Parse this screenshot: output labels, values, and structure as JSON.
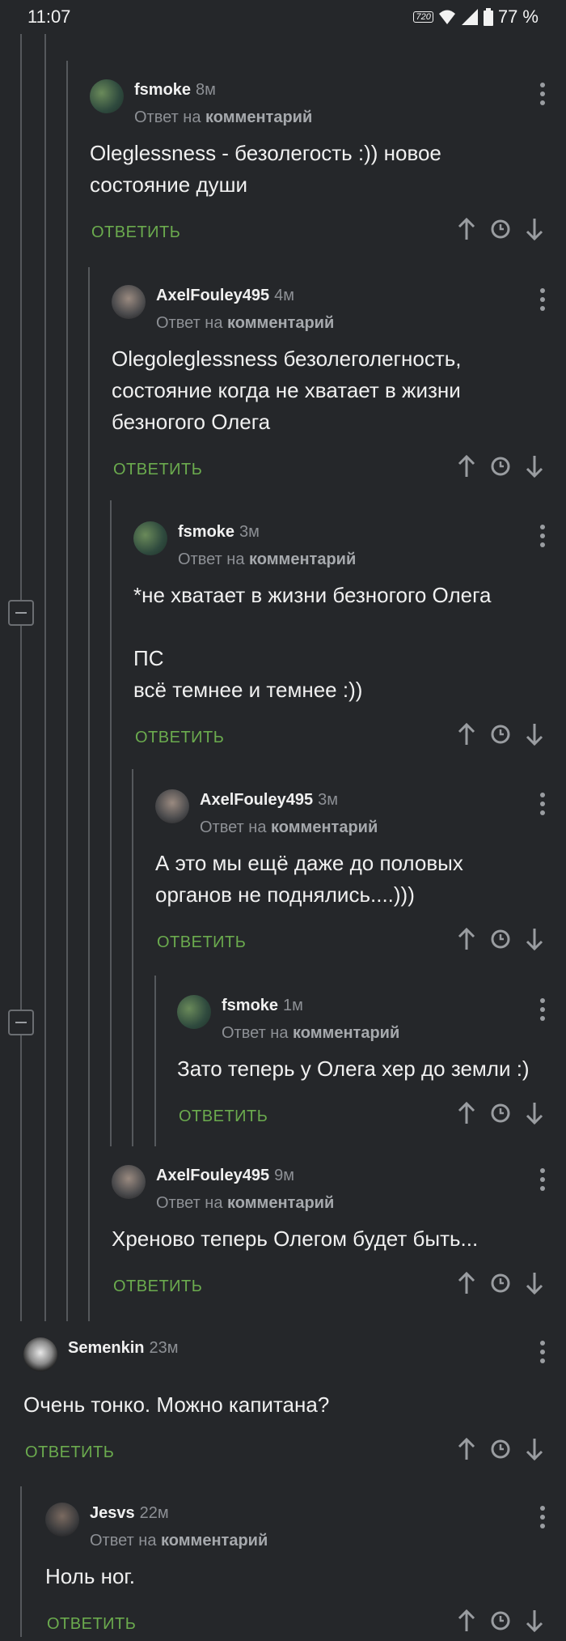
{
  "status_bar": {
    "time": "11:07",
    "battery": "77 %",
    "hd_label": "720"
  },
  "colors": {
    "accent_green": "#6bab4e",
    "background": "#25272a",
    "thread_line": "#55585c"
  },
  "icons": {
    "upvote": "arrow-up-icon",
    "history": "clock-icon",
    "downvote": "arrow-down-icon",
    "menu": "more-vertical-icon",
    "collapse": "minus-square-icon"
  },
  "comments": [
    {
      "author": "fsmoke",
      "time": "8м",
      "reply_to": "Ответ на",
      "reply_to_target": "комментарий",
      "text": "Oleglessness - безолегость :)) новое\nсостояние души",
      "reply_label": "ОТВЕТИТЬ"
    },
    {
      "author": "AxelFouley495",
      "time": "4м",
      "reply_to": "Ответ на",
      "reply_to_target": "комментарий",
      "text": "Olegoleglessness безолеголегность,\nсостояние когда не хватает в жизни\nбезногого Олега",
      "reply_label": "ОТВЕТИТЬ"
    },
    {
      "author": "fsmoke",
      "time": "3м",
      "reply_to": "Ответ на",
      "reply_to_target": "комментарий",
      "text": "*не хватает в жизни безногого Олега\n\nПС\nвсё темнее и темнее :))",
      "reply_label": "ОТВЕТИТЬ"
    },
    {
      "author": "AxelFouley495",
      "time": "3м",
      "reply_to": "Ответ на",
      "reply_to_target": "комментарий",
      "text": "А это мы ещё даже до половых\nорганов не поднялись....)))",
      "reply_label": "ОТВЕТИТЬ"
    },
    {
      "author": "fsmoke",
      "time": "1м",
      "reply_to": "Ответ на",
      "reply_to_target": "комментарий",
      "text": "Зато теперь у Олега хер до земли :)",
      "reply_label": "ОТВЕТИТЬ"
    },
    {
      "author": "AxelFouley495",
      "time": "9м",
      "reply_to": "Ответ на",
      "reply_to_target": "комментарий",
      "text": "Хреново теперь Олегом будет быть...",
      "reply_label": "ОТВЕТИТЬ"
    },
    {
      "author": "Semenkin",
      "time": "23м",
      "reply_to": "",
      "reply_to_target": "",
      "text": "Очень тонко. Можно капитана?",
      "reply_label": "ОТВЕТИТЬ"
    },
    {
      "author": "Jesvs",
      "time": "22м",
      "reply_to": "Ответ на",
      "reply_to_target": "комментарий",
      "text": "Ноль ног.",
      "reply_label": "ОТВЕТИТЬ"
    }
  ]
}
